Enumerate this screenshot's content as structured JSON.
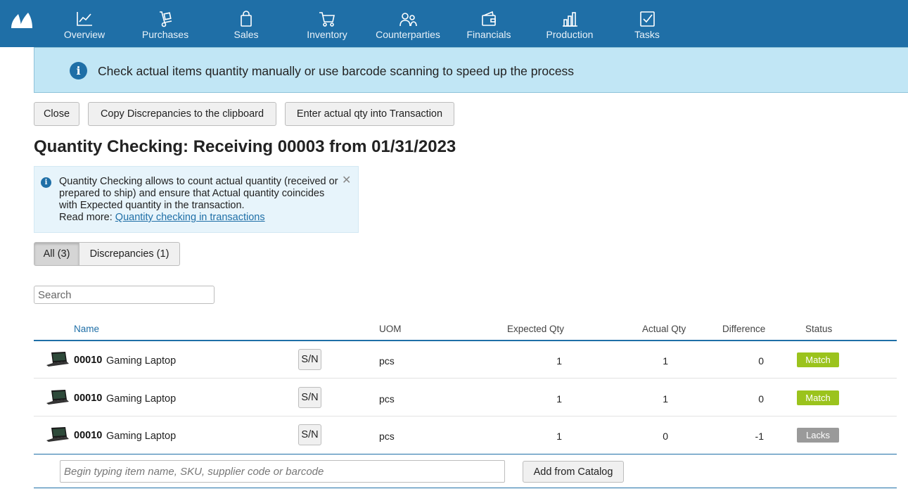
{
  "nav": {
    "items": [
      {
        "label": "Overview",
        "icon": "chart-line-icon"
      },
      {
        "label": "Purchases",
        "icon": "hand-truck-icon"
      },
      {
        "label": "Sales",
        "icon": "shopping-bag-icon"
      },
      {
        "label": "Inventory",
        "icon": "cart-icon"
      },
      {
        "label": "Counterparties",
        "icon": "people-icon"
      },
      {
        "label": "Financials",
        "icon": "wallet-icon"
      },
      {
        "label": "Production",
        "icon": "factory-icon"
      },
      {
        "label": "Tasks",
        "icon": "checkbox-icon"
      }
    ]
  },
  "banner": {
    "text": "Check actual items quantity manually or use barcode scanning to speed up the process"
  },
  "actions": {
    "close": "Close",
    "copy": "Copy Discrepancies to the clipboard",
    "enter": "Enter actual qty into Transaction"
  },
  "page": {
    "title": "Quantity Checking: Receiving 00003 from 01/31/2023"
  },
  "info": {
    "line1": "Quantity Checking allows to count actual quantity (received or",
    "line2": "prepared to ship) and ensure that Actual quantity coincides",
    "line3": "with Expected quantity in the transaction.",
    "read_more": "Read more:",
    "link": "Quantity checking in transactions"
  },
  "filters": {
    "all": "All (3)",
    "discrepancies": "Discrepancies (1)"
  },
  "search": {
    "placeholder": "Search"
  },
  "table": {
    "headers": {
      "name": "Name",
      "uom": "UOM",
      "expected": "Expected Qty",
      "actual": "Actual Qty",
      "difference": "Difference",
      "status": "Status"
    },
    "rows": [
      {
        "sku": "00010",
        "name": "Gaming Laptop",
        "sn": "S/N",
        "uom": "pcs",
        "expected": "1",
        "actual": "1",
        "difference": "0",
        "status": "Match",
        "status_color": "#9bc31d"
      },
      {
        "sku": "00010",
        "name": "Gaming Laptop",
        "sn": "S/N",
        "uom": "pcs",
        "expected": "1",
        "actual": "1",
        "difference": "0",
        "status": "Match",
        "status_color": "#9bc31d"
      },
      {
        "sku": "00010",
        "name": "Gaming Laptop",
        "sn": "S/N",
        "uom": "pcs",
        "expected": "1",
        "actual": "0",
        "difference": "-1",
        "status": "Lacks",
        "status_color": "#9a9a9a"
      }
    ]
  },
  "add": {
    "placeholder": "Begin typing item name, SKU, supplier code or barcode",
    "catalog_button": "Add from Catalog"
  },
  "colors": {
    "nav": "#1f6fa7",
    "banner": "#c1e6f5",
    "match": "#9bc31d",
    "lacks": "#9a9a9a"
  }
}
